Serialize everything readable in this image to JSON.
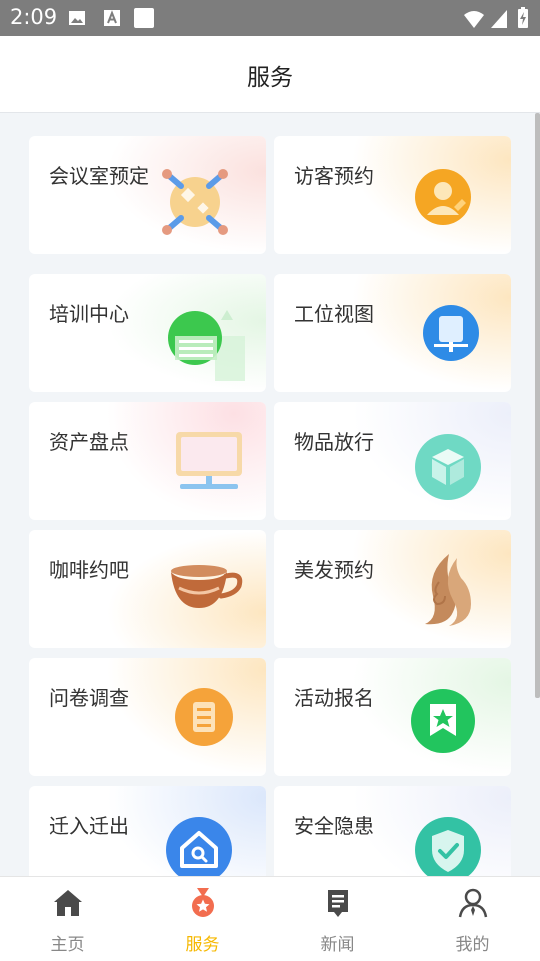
{
  "status_bar": {
    "time": "2:09"
  },
  "header": {
    "title": "服务"
  },
  "services": [
    {
      "label": "会议室预定",
      "icon": "meeting-room-icon",
      "tint": "#fbe3e3"
    },
    {
      "label": "访客预约",
      "icon": "visitor-icon",
      "tint": "#fde9c8"
    },
    {
      "label": "培训中心",
      "icon": "training-icon",
      "tint": "#e6f6e6"
    },
    {
      "label": "工位视图",
      "icon": "workstation-icon",
      "tint": "#fde9c8"
    },
    {
      "label": "资产盘点",
      "icon": "asset-monitor-icon",
      "tint": "#fde3e6"
    },
    {
      "label": "物品放行",
      "icon": "package-box-icon",
      "tint": "#eceffa"
    },
    {
      "label": "咖啡约吧",
      "icon": "coffee-cup-icon",
      "tint": "#fde9c8"
    },
    {
      "label": "美发预约",
      "icon": "hair-salon-icon",
      "tint": "#fde9c8"
    },
    {
      "label": "问卷调查",
      "icon": "survey-icon",
      "tint": "#fde9c8"
    },
    {
      "label": "活动报名",
      "icon": "event-signup-icon",
      "tint": "#e6f6e6"
    },
    {
      "label": "迁入迁出",
      "icon": "move-house-icon",
      "tint": "#dfe9fb"
    },
    {
      "label": "安全隐患",
      "icon": "safety-shield-icon",
      "tint": "#eceffa"
    }
  ],
  "tab_bar": {
    "tabs": [
      {
        "label": "主页",
        "icon": "home-icon",
        "active": false
      },
      {
        "label": "服务",
        "icon": "service-medal-icon",
        "active": true
      },
      {
        "label": "新闻",
        "icon": "news-icon",
        "active": false
      },
      {
        "label": "我的",
        "icon": "profile-icon",
        "active": false
      }
    ],
    "active_color": "#f6b800",
    "inactive_color": "#888888"
  }
}
